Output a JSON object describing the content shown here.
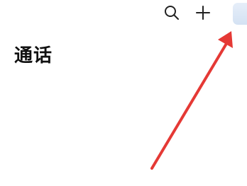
{
  "header": {
    "title": "通话"
  },
  "toolbar": {
    "search_icon": "search-icon",
    "add_icon": "plus-icon",
    "avatar": "avatar"
  },
  "annotation": {
    "type": "arrow",
    "color": "#e53935",
    "points_to": "avatar"
  }
}
